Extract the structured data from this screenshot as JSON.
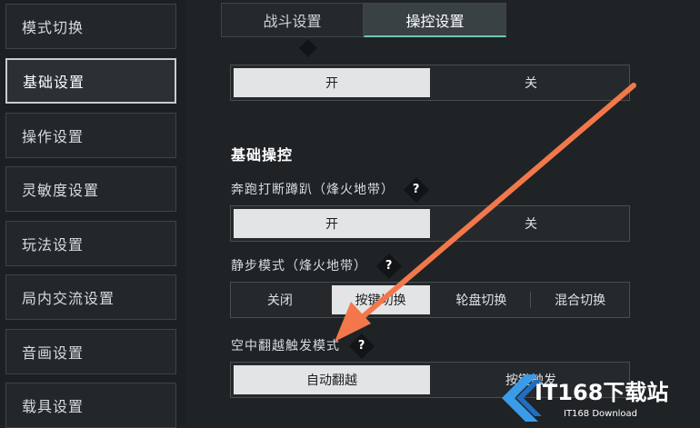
{
  "sidebar": {
    "items": [
      {
        "label": "模式切换"
      },
      {
        "label": "基础设置"
      },
      {
        "label": "操作设置"
      },
      {
        "label": "灵敏度设置"
      },
      {
        "label": "玩法设置"
      },
      {
        "label": "局内交流设置"
      },
      {
        "label": "音画设置"
      },
      {
        "label": "载具设置"
      }
    ],
    "active_index": 1
  },
  "tabs": [
    {
      "label": "战斗设置"
    },
    {
      "label": "操控设置"
    }
  ],
  "top_toggle": {
    "on_label": "开",
    "off_label": "关",
    "selected": "开"
  },
  "section": {
    "title": "基础操控"
  },
  "settings": [
    {
      "label": "奔跑打断蹲趴（烽火地带）",
      "help": "?",
      "options": [
        "开",
        "关"
      ],
      "selected": "开"
    },
    {
      "label": "静步模式（烽火地带）",
      "help": "?",
      "options": [
        "关闭",
        "按键切换",
        "轮盘切换",
        "混合切换"
      ],
      "selected": "按键切换"
    },
    {
      "label": "空中翻越触发模式",
      "help": "?",
      "options": [
        "自动翻越",
        "按键触发"
      ],
      "selected": "自动翻越"
    }
  ],
  "annotation": {
    "arrow_color": "#f2784b"
  },
  "watermark": {
    "text": "IT168下载站",
    "sub": "IT168 Download"
  }
}
